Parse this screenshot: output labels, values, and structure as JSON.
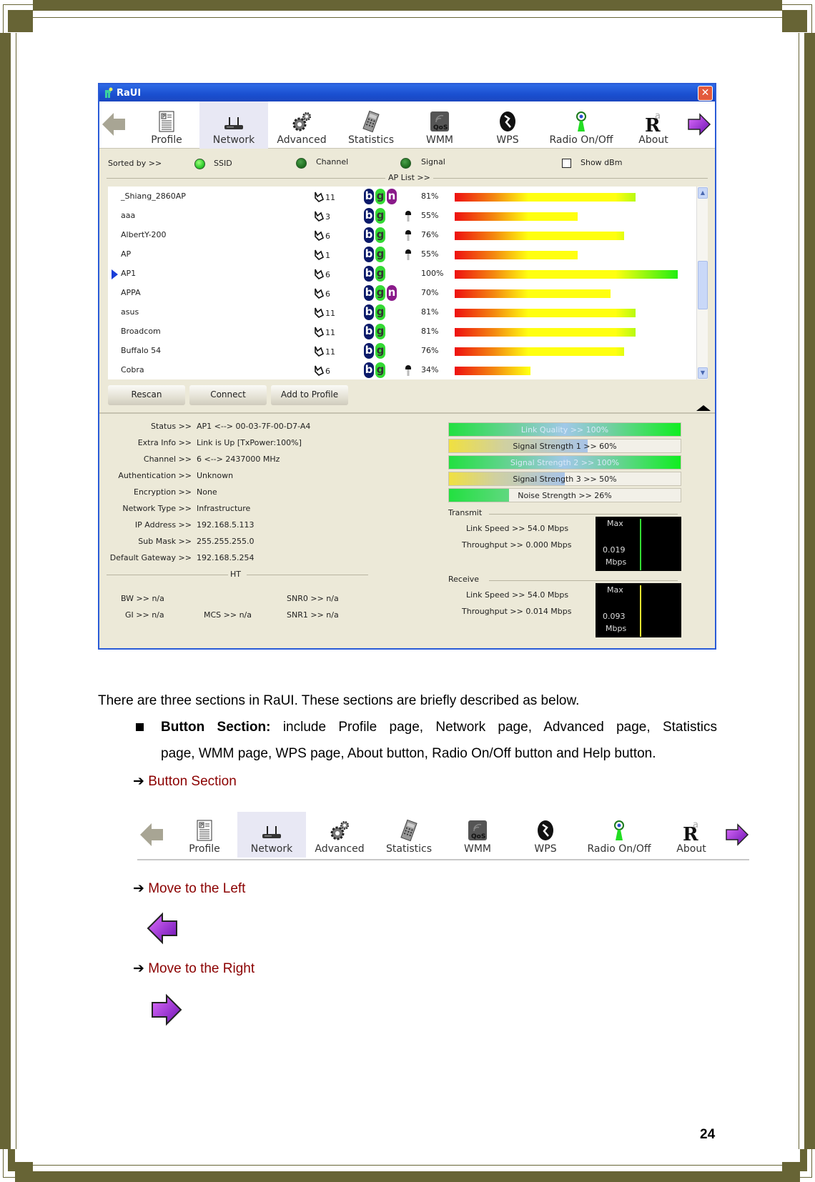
{
  "window": {
    "title": "RaUI",
    "close_label": "✕"
  },
  "toolbar": {
    "items": [
      {
        "label": "Profile",
        "icon": "profile-icon"
      },
      {
        "label": "Network",
        "icon": "network-icon",
        "active": true
      },
      {
        "label": "Advanced",
        "icon": "advanced-gears-icon"
      },
      {
        "label": "Statistics",
        "icon": "statistics-icon"
      },
      {
        "label": "WMM",
        "icon": "wmm-qos-icon"
      },
      {
        "label": "WPS",
        "icon": "wps-icon"
      },
      {
        "label": "Radio On/Off",
        "icon": "radio-icon"
      },
      {
        "label": "About",
        "icon": "about-icon"
      }
    ],
    "left_arrow": "move-left-arrow",
    "right_arrow": "move-right-arrow"
  },
  "sort": {
    "label": "Sorted by >>",
    "options": [
      "SSID",
      "Channel",
      "Signal"
    ],
    "selected": "SSID",
    "show_dbm_label": "Show dBm",
    "show_dbm_checked": false
  },
  "ap_list": {
    "title": "AP List >>",
    "rows": [
      {
        "ssid": "_Shiang_2860AP",
        "channel": "11",
        "b": true,
        "g": true,
        "n": true,
        "secured": false,
        "signal": 81,
        "signal_label": "81%"
      },
      {
        "ssid": "aaa",
        "channel": "3",
        "b": true,
        "g": true,
        "n": false,
        "secured": true,
        "signal": 55,
        "signal_label": "55%"
      },
      {
        "ssid": "AlbertY-200",
        "channel": "6",
        "b": true,
        "g": true,
        "n": false,
        "secured": true,
        "signal": 76,
        "signal_label": "76%"
      },
      {
        "ssid": "AP",
        "channel": "1",
        "b": true,
        "g": true,
        "n": false,
        "secured": true,
        "signal": 55,
        "signal_label": "55%"
      },
      {
        "ssid": "AP1",
        "channel": "6",
        "b": true,
        "g": true,
        "n": false,
        "secured": false,
        "signal": 100,
        "signal_label": "100%",
        "selected": true
      },
      {
        "ssid": "APPA",
        "channel": "6",
        "b": true,
        "g": true,
        "n": true,
        "secured": false,
        "signal": 70,
        "signal_label": "70%"
      },
      {
        "ssid": "asus",
        "channel": "11",
        "b": true,
        "g": true,
        "n": false,
        "secured": false,
        "signal": 81,
        "signal_label": "81%"
      },
      {
        "ssid": "Broadcom",
        "channel": "11",
        "b": true,
        "g": true,
        "n": false,
        "secured": false,
        "signal": 81,
        "signal_label": "81%"
      },
      {
        "ssid": "Buffalo 54",
        "channel": "11",
        "b": true,
        "g": true,
        "n": false,
        "secured": false,
        "signal": 76,
        "signal_label": "76%"
      },
      {
        "ssid": "Cobra",
        "channel": "6",
        "b": true,
        "g": true,
        "n": false,
        "secured": true,
        "signal": 34,
        "signal_label": "34%"
      }
    ]
  },
  "buttons": {
    "rescan": "Rescan",
    "connect": "Connect",
    "add_to_profile": "Add to Profile"
  },
  "status": {
    "fields": [
      {
        "label": "Status >>",
        "value": "AP1 <--> 00-03-7F-00-D7-A4"
      },
      {
        "label": "Extra Info >>",
        "value": "Link is Up [TxPower:100%]"
      },
      {
        "label": "Channel >>",
        "value": "6 <--> 2437000 MHz"
      },
      {
        "label": "Authentication >>",
        "value": "Unknown"
      },
      {
        "label": "Encryption >>",
        "value": "None"
      },
      {
        "label": "Network Type >>",
        "value": "Infrastructure"
      },
      {
        "label": "IP Address >>",
        "value": "192.168.5.113"
      },
      {
        "label": "Sub Mask >>",
        "value": "255.255.255.0"
      },
      {
        "label": "Default Gateway >>",
        "value": "192.168.5.254"
      }
    ],
    "ht_title": "HT",
    "ht": {
      "bw": "BW >> n/a",
      "gi": "GI >> n/a",
      "mcs": "MCS >> n/a",
      "snr0": "SNR0 >> n/a",
      "snr1": "SNR1 >> n/a"
    }
  },
  "quality": [
    {
      "label": "Link Quality >> 100%",
      "value": 100,
      "kind": "green"
    },
    {
      "label": "Signal Strength 1 >> 60%",
      "value": 60,
      "kind": "yellow"
    },
    {
      "label": "Signal Strength 2 >> 100%",
      "value": 100,
      "kind": "green"
    },
    {
      "label": "Signal Strength 3 >> 50%",
      "value": 50,
      "kind": "yellow"
    },
    {
      "label": "Noise Strength >> 26%",
      "value": 26,
      "kind": "noise"
    }
  ],
  "transmit": {
    "title": "Transmit",
    "link_speed": "Link Speed >> 54.0 Mbps",
    "throughput": "Throughput >> 0.000 Mbps",
    "graph_max": "Max",
    "graph_value": "0.019",
    "graph_unit": "Mbps",
    "graph_color": "#33dd33"
  },
  "receive": {
    "title": "Receive",
    "link_speed": "Link Speed >> 54.0 Mbps",
    "throughput": "Throughput >> 0.014 Mbps",
    "graph_max": "Max",
    "graph_value": "0.093",
    "graph_unit": "Mbps",
    "graph_color": "#e8e830"
  },
  "doc": {
    "intro": "There are three sections in RaUI. These sections are briefly described as below.",
    "bullet_bold": "Button Section:",
    "bullet_line1": " include Profile page, Network page, Advanced page, Statistics",
    "bullet_line2": "page, WMM page, WPS page, About button, Radio On/Off button and Help button.",
    "arrow": "➔",
    "button_section": "Button Section",
    "move_left": "Move to the Left",
    "move_right": "Move to the Right",
    "page_number": "24"
  },
  "colors": {
    "frame": "#676435",
    "accent_red": "#8b0000",
    "title_blue": "#1a4fd0"
  }
}
